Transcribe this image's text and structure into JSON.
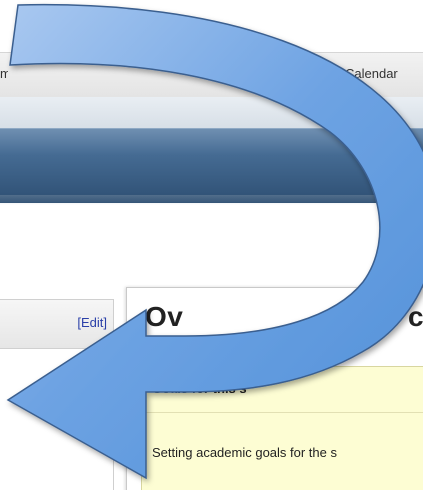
{
  "nav": {
    "tab_left_fragment": "me",
    "tab_calendar": "Calendar"
  },
  "left_panel": {
    "edit_label": "[Edit]"
  },
  "main_panel": {
    "title_fragment": "Ov",
    "title_right_fragment": "c",
    "goals_header": "Goals for this s",
    "goals_text": "Setting academic goals for the s"
  },
  "overlay": {
    "arrow_icon": "curved-arrow-icon",
    "arrow_color": "#5b95dd"
  }
}
